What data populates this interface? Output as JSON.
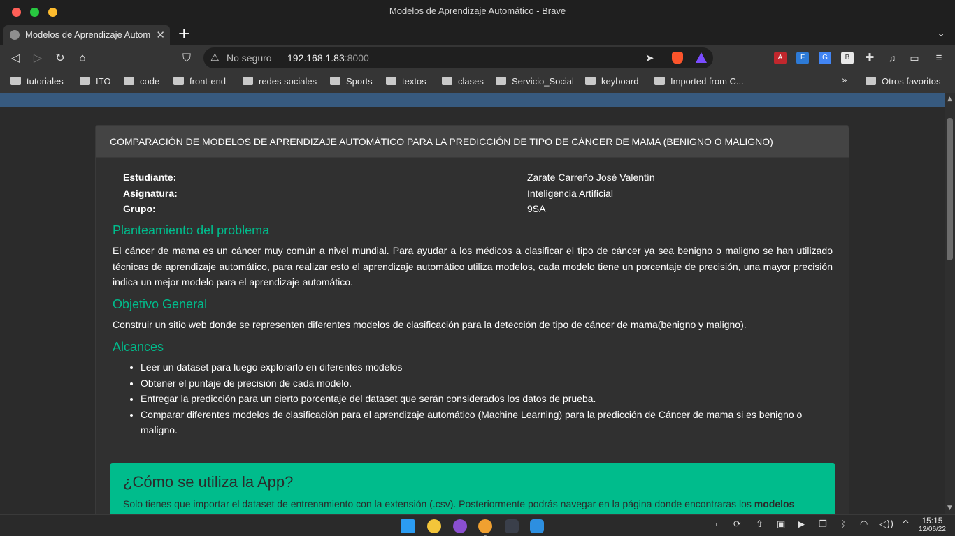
{
  "window": {
    "title": "Modelos de Aprendizaje Automático - Brave"
  },
  "tab": {
    "title": "Modelos de Aprendizaje Autom",
    "close": "✕",
    "new_tab": "+",
    "list": "⌄"
  },
  "address": {
    "security": "No seguro",
    "host": "192.168.1.83",
    "port": ":8000"
  },
  "bookmarks": {
    "items": [
      "tutoriales",
      "ITO",
      "code",
      "front-end",
      "redes sociales",
      "Sports",
      "textos",
      "clases",
      "Servicio_Social",
      "keyboard",
      "Imported from C..."
    ],
    "more": "»",
    "other": "Otros favoritos"
  },
  "page": {
    "header": "COMPARACIÓN DE MODELOS DE APRENDIZAJE AUTOMÁTICO PARA LA PREDICCIÓN DE TIPO DE CÁNCER DE MAMA (BENIGNO O MALIGNO)",
    "info": [
      {
        "label": "Estudiante:",
        "value": "Zarate Carreño José Valentín"
      },
      {
        "label": "Asignatura:",
        "value": "Inteligencia Artificial"
      },
      {
        "label": "Grupo:",
        "value": "9SA"
      }
    ],
    "problem_title": "Planteamiento del problema",
    "problem_text": "El cáncer de mama es un cáncer muy común a nivel mundial. Para ayudar a los médicos a clasificar el tipo de cáncer ya sea benigno o maligno se han utilizado técnicas de aprendizaje automático, para realizar esto el aprendizaje automático utiliza modelos, cada modelo tiene un porcentaje de precisión, una mayor precisión indica un mejor modelo para el aprendizaje automático.",
    "objective_title": "Objetivo General",
    "objective_text": "Construir un sitio web donde se representen diferentes modelos de clasificación para la detección de tipo de cáncer de mama(benigno y maligno).",
    "scope_title": "Alcances",
    "scope_items": [
      "Leer un dataset para luego explorarlo en diferentes modelos",
      "Obtener el puntaje de precisión de cada modelo.",
      "Entregar la predicción para un cierto porcentaje del dataset que serán considerados los datos de prueba.",
      "Comparar diferentes modelos de clasificación para el aprendizaje automático (Machine Learning) para la predicción de Cáncer de mama si es benigno o maligno."
    ],
    "alert_title": "¿Cómo se utiliza la App?",
    "alert_text": "Solo tienes que importar el dataset de entrenamiento con la extensión (.csv). Posteriormente podrás navegar en la página donde encontraras los ",
    "alert_bold": "modelos"
  },
  "taskbar": {
    "time": "15:15",
    "date": "12/06/22"
  },
  "colors": {
    "accent": "#00bc8c",
    "navbar": "#375a7f",
    "background": "#2b2b2b"
  }
}
